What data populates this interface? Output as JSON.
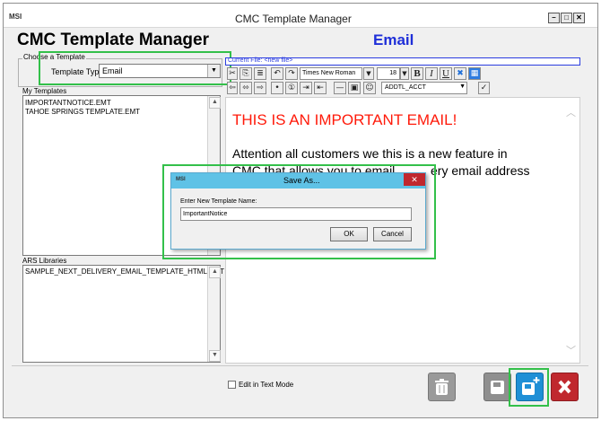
{
  "window": {
    "title": "CMC Template Manager",
    "app_icon": "MSI"
  },
  "header": {
    "title": "CMC Template Manager",
    "mode": "Email"
  },
  "template_type": {
    "group_label": "Choose a Template",
    "label": "Template Type",
    "value": "Email"
  },
  "my_templates": {
    "label": "My Templates",
    "items": [
      "IMPORTANTNOTICE.EMT",
      "TAHOE SPRINGS TEMPLATE.EMT"
    ]
  },
  "ars_libraries": {
    "label": "ARS Libraries",
    "items": [
      "SAMPLE_NEXT_DELIVERY_EMAIL_TEMPLATE_HTML.EMT"
    ]
  },
  "editor": {
    "current_file": "Current File: <new file>",
    "font_name": "Times New Roman",
    "font_size": "18",
    "field_select": "ADDTL_ACCT",
    "heading_text": "THIS IS AN IMPORTANT EMAIL!",
    "body_line1": "Attention all customers we this is a new feature in",
    "body_line2_left": "CMC that allows you to email ",
    "body_line2_right": "ery email address",
    "heading_color": "#ff1a0a"
  },
  "dialog": {
    "title": "Save As...",
    "label": "Enter New Template Name:",
    "value": "ImportantNotice",
    "ok_label": "OK",
    "cancel_label": "Cancel"
  },
  "footer": {
    "edit_text_mode_label": "Edit in Text Mode"
  },
  "colors": {
    "highlight": "#33c04a",
    "header_blue": "#1f2fd8",
    "dialog_title_bg": "#5fc2e6",
    "close_red": "#c0282e"
  }
}
